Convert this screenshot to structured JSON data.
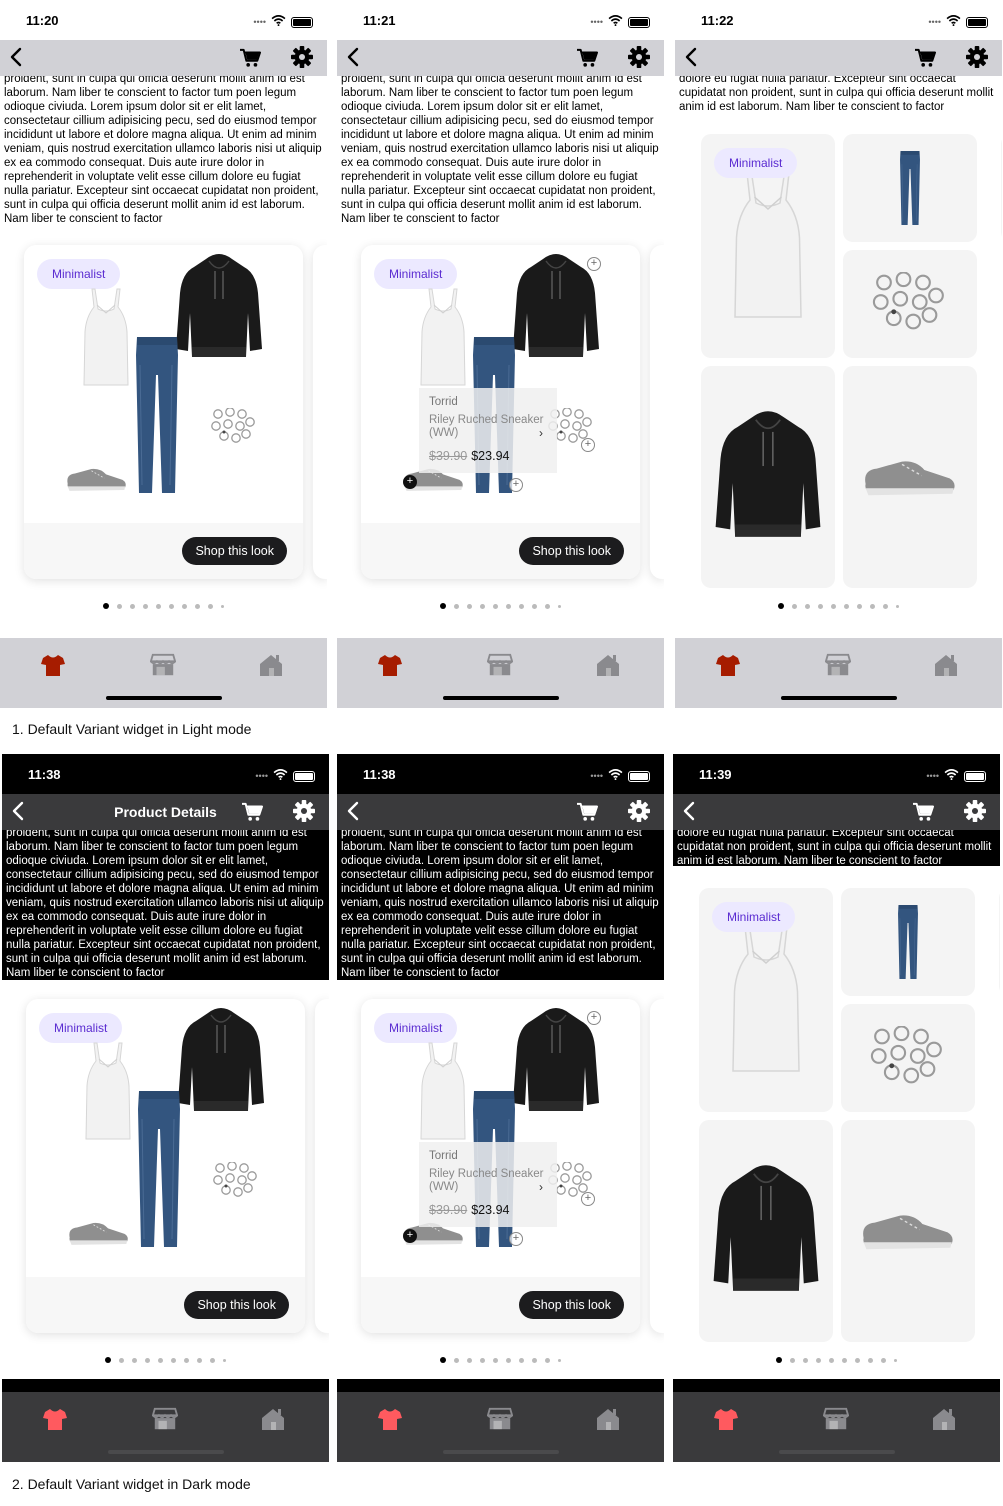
{
  "screens": [
    {
      "time": "11:20",
      "mode": "light",
      "variant": "look",
      "title": ""
    },
    {
      "time": "11:21",
      "mode": "light",
      "variant": "look-popup",
      "title": ""
    },
    {
      "time": "11:22",
      "mode": "light",
      "variant": "grid",
      "title": ""
    },
    {
      "time": "11:38",
      "mode": "dark",
      "variant": "look",
      "title": "Product Details"
    },
    {
      "time": "11:38",
      "mode": "dark",
      "variant": "look-popup",
      "title": ""
    },
    {
      "time": "11:39",
      "mode": "dark",
      "variant": "grid",
      "title": ""
    }
  ],
  "lorem_text": "proident, sunt in culpa qui officia deserunt mollit anim id est laborum. Nam liber te conscient to factor tum poen legum odioque civiuda. Lorem ipsum dolor sit er elit lamet, consectetaur cillium adipisicing pecu, sed do eiusmod tempor incididunt ut labore et dolore magna aliqua. Ut enim ad minim veniam, quis nostrud exercitation ullamco laboris nisi ut aliquip ex ea commodo consequat. Duis aute irure dolor in reprehenderit in voluptate velit esse cillum dolore eu fugiat nulla pariatur. Excepteur sint occaecat cupidatat non proident, sunt in culpa qui officia deserunt mollit anim id est laborum. Nam liber te conscient to factor",
  "lorem_short": "dolore eu fugiat nulla pariatur. Excepteur sint occaecat cupidatat non proident, sunt in culpa qui officia deserunt mollit anim id est laborum. Nam liber te conscient to factor",
  "card": {
    "tag": "Minimalist",
    "cta": "Shop this look"
  },
  "popup": {
    "brand": "Torrid",
    "product": "Riley Ruched Sneaker (WW)",
    "old_price": "$39.90",
    "price": "$23.94"
  },
  "pagination": {
    "count": 10,
    "active": 0
  },
  "captions": {
    "light": "1. Default Variant widget in Light mode",
    "dark": "2. Default Variant widget in Dark mode"
  },
  "colors": {
    "tag_bg": "#ece9ff",
    "tag_text": "#5a2bd1",
    "tab_active_light": "#a61c00",
    "tab_active_dark": "#ff5a5f",
    "bar_light": "#d1d1d6",
    "bar_dark": "#3a3a3c"
  },
  "icons": [
    "back-chevron-icon",
    "cart-icon",
    "gear-icon",
    "tshirt-icon",
    "store-icon",
    "home-icon",
    "plus-icon",
    "chevron-right-icon",
    "wifi-icon",
    "battery-icon"
  ]
}
